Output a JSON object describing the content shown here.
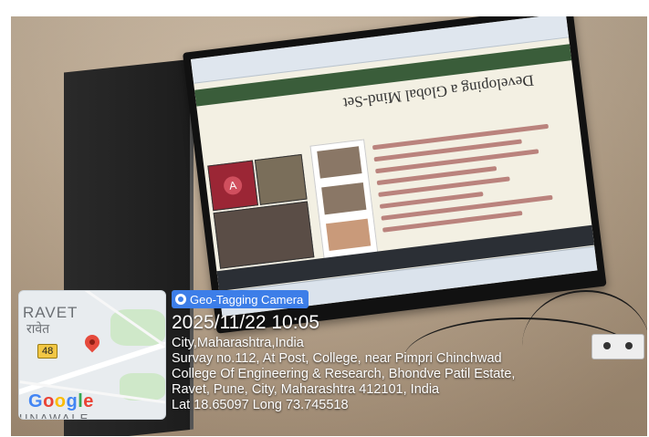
{
  "map": {
    "label_top": "RAVET",
    "label_hindi": "रावेत",
    "road_shield": "48",
    "label_bottom": "UNAWALE",
    "logo_letters": [
      "G",
      "o",
      "o",
      "g",
      "l",
      "e"
    ],
    "pin_icon": "map-pin-icon"
  },
  "badge": {
    "label": "Geo-Tagging Camera",
    "icon": "camera-icon",
    "color": "#3d7ee8"
  },
  "stamp": {
    "datetime": "2025/11/22 10:05",
    "lines": [
      "City,Maharashtra,India",
      "Survay no.112, At Post, College, near Pimpri Chinchwad",
      "College Of Engineering & Research, Bhondve Patil Estate,",
      "Ravet, Pune, City, Maharashtra 412101, India",
      "Lat 18.65097 Long 73.745518"
    ]
  },
  "screen": {
    "slide_title": "Developing a Global Mind-Set"
  }
}
